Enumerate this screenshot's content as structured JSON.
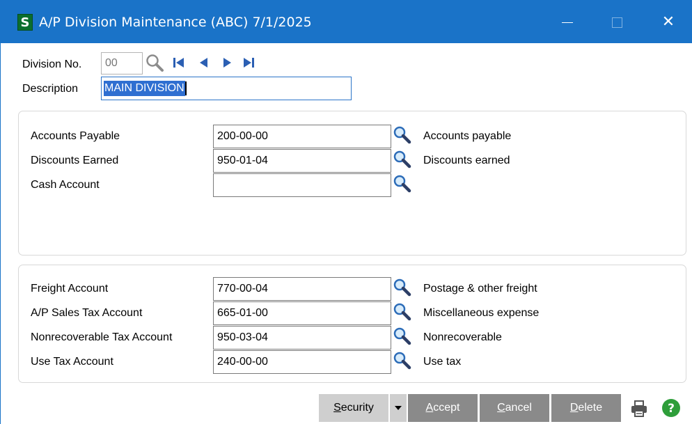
{
  "window": {
    "app_icon_letter": "S",
    "title": "A/P Division Maintenance (ABC) 7/1/2025",
    "minimize": "—",
    "close": "✕"
  },
  "header": {
    "division_label": "Division No.",
    "division_value": "00",
    "description_label": "Description",
    "description_value": "MAIN DIVISION"
  },
  "panel1": {
    "rows": [
      {
        "label": "Accounts Payable",
        "value": "200-00-00",
        "desc": "Accounts payable"
      },
      {
        "label": "Discounts Earned",
        "value": "950-01-04",
        "desc": "Discounts earned"
      },
      {
        "label": "Cash Account",
        "value": "",
        "desc": ""
      }
    ]
  },
  "panel2": {
    "rows": [
      {
        "label": "Freight Account",
        "value": "770-00-04",
        "desc": "Postage & other freight"
      },
      {
        "label": "A/P Sales Tax Account",
        "value": "665-01-00",
        "desc": "Miscellaneous expense"
      },
      {
        "label": "Nonrecoverable Tax Account",
        "value": "950-03-04",
        "desc": "Nonrecoverable"
      },
      {
        "label": "Use Tax Account",
        "value": "240-00-00",
        "desc": "Use tax"
      }
    ]
  },
  "buttons": {
    "security_first": "S",
    "security_rest": "ecurity",
    "accept_first": "A",
    "accept_rest": "ccept",
    "cancel_first": "C",
    "cancel_rest": "ancel",
    "delete_first": "D",
    "delete_rest": "elete"
  },
  "colors": {
    "titlebar": "#1a73c8",
    "selection": "#2f6fd1",
    "button_dark": "#8a8a8a",
    "button_light": "#cfcfcf",
    "help_green": "#2e9e3a"
  },
  "icons": [
    "app-icon",
    "minimize-icon",
    "maximize-icon",
    "close-icon",
    "magnifier-icon",
    "first-record-icon",
    "previous-record-icon",
    "next-record-icon",
    "last-record-icon",
    "dropdown-arrow-icon",
    "printer-icon",
    "help-icon"
  ]
}
